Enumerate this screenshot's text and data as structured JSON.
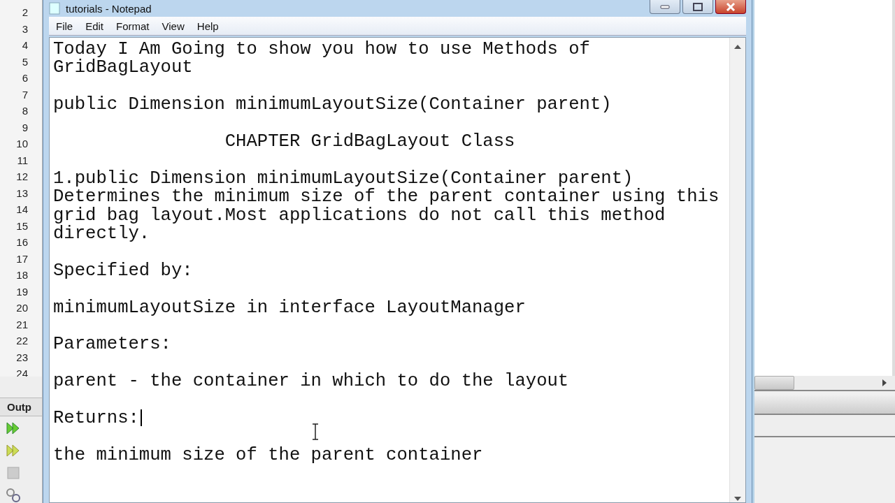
{
  "ide": {
    "line_numbers": [
      "2",
      "3",
      "4",
      "5",
      "6",
      "7",
      "8",
      "9",
      "10",
      "11",
      "12",
      "13",
      "14",
      "15",
      "16",
      "17",
      "18",
      "19",
      "20",
      "21",
      "22",
      "23",
      "24"
    ],
    "output_tab": "Outp"
  },
  "window": {
    "title": "tutorials - Notepad"
  },
  "menu": [
    "File",
    "Edit",
    "Format",
    "View",
    "Help"
  ],
  "editor": {
    "paragraphs": [
      {
        "text": "Today I Am Going to show you how to use Methods of\nGridBagLayout",
        "kind": "plain",
        "caret": false
      },
      {
        "text": "public Dimension minimumLayoutSize(Container parent)",
        "kind": "plain",
        "caret": false
      },
      {
        "text": "CHAPTER GridBagLayout Class",
        "kind": "indented",
        "caret": false
      },
      {
        "text": "1.public Dimension minimumLayoutSize(Container parent)\nDetermines the minimum size of the parent container using this\ngrid bag layout.Most applications do not call this method\ndirectly.",
        "kind": "plain",
        "caret": false
      },
      {
        "text": "Specified by:",
        "kind": "plain",
        "caret": false
      },
      {
        "text": "minimumLayoutSize in interface LayoutManager",
        "kind": "plain",
        "caret": false
      },
      {
        "text": "Parameters:",
        "kind": "plain",
        "caret": false
      },
      {
        "text": "parent - the container in which to do the layout",
        "kind": "plain",
        "caret": false
      },
      {
        "text": "Returns:",
        "kind": "plain",
        "caret": true
      },
      {
        "text": "the minimum size of the parent container",
        "kind": "plain",
        "caret": false
      }
    ]
  }
}
